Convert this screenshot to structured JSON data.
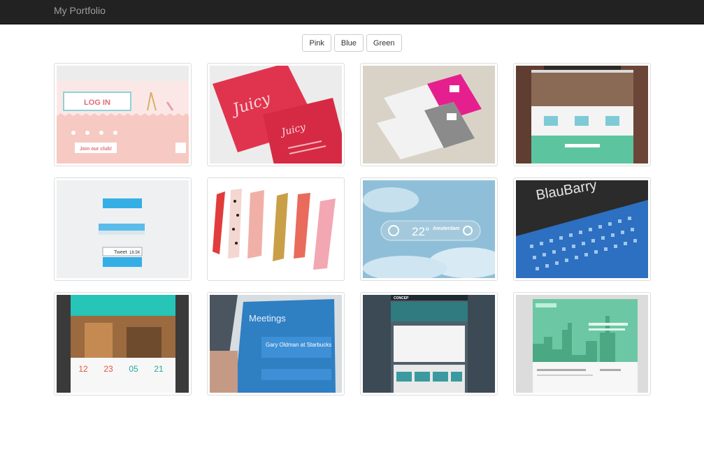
{
  "navbar": {
    "brand": "My Portfolio"
  },
  "filters": [
    {
      "label": "Pink"
    },
    {
      "label": "Blue"
    },
    {
      "label": "Green"
    }
  ],
  "gallery": {
    "items": [
      {
        "theme": "pink",
        "texts": [
          "LOG IN",
          "Join our club!"
        ]
      },
      {
        "theme": "pink",
        "texts": [
          "Juicy",
          "Juicy"
        ]
      },
      {
        "theme": "pink",
        "texts": []
      },
      {
        "theme": "green",
        "texts": []
      },
      {
        "theme": "blue",
        "texts": [
          "Tweet",
          "18.5K"
        ]
      },
      {
        "theme": "pink",
        "texts": []
      },
      {
        "theme": "blue",
        "texts": [
          "22°",
          "Amsterdam"
        ]
      },
      {
        "theme": "blue",
        "texts": [
          "BlauBarry"
        ]
      },
      {
        "theme": "green",
        "texts": [
          "12",
          "23",
          "05",
          "21"
        ]
      },
      {
        "theme": "blue",
        "texts": [
          "Meetings",
          "Gary Oldman at Starbucks"
        ]
      },
      {
        "theme": "blue",
        "texts": [
          "CONCEP"
        ]
      },
      {
        "theme": "green",
        "texts": []
      }
    ]
  }
}
